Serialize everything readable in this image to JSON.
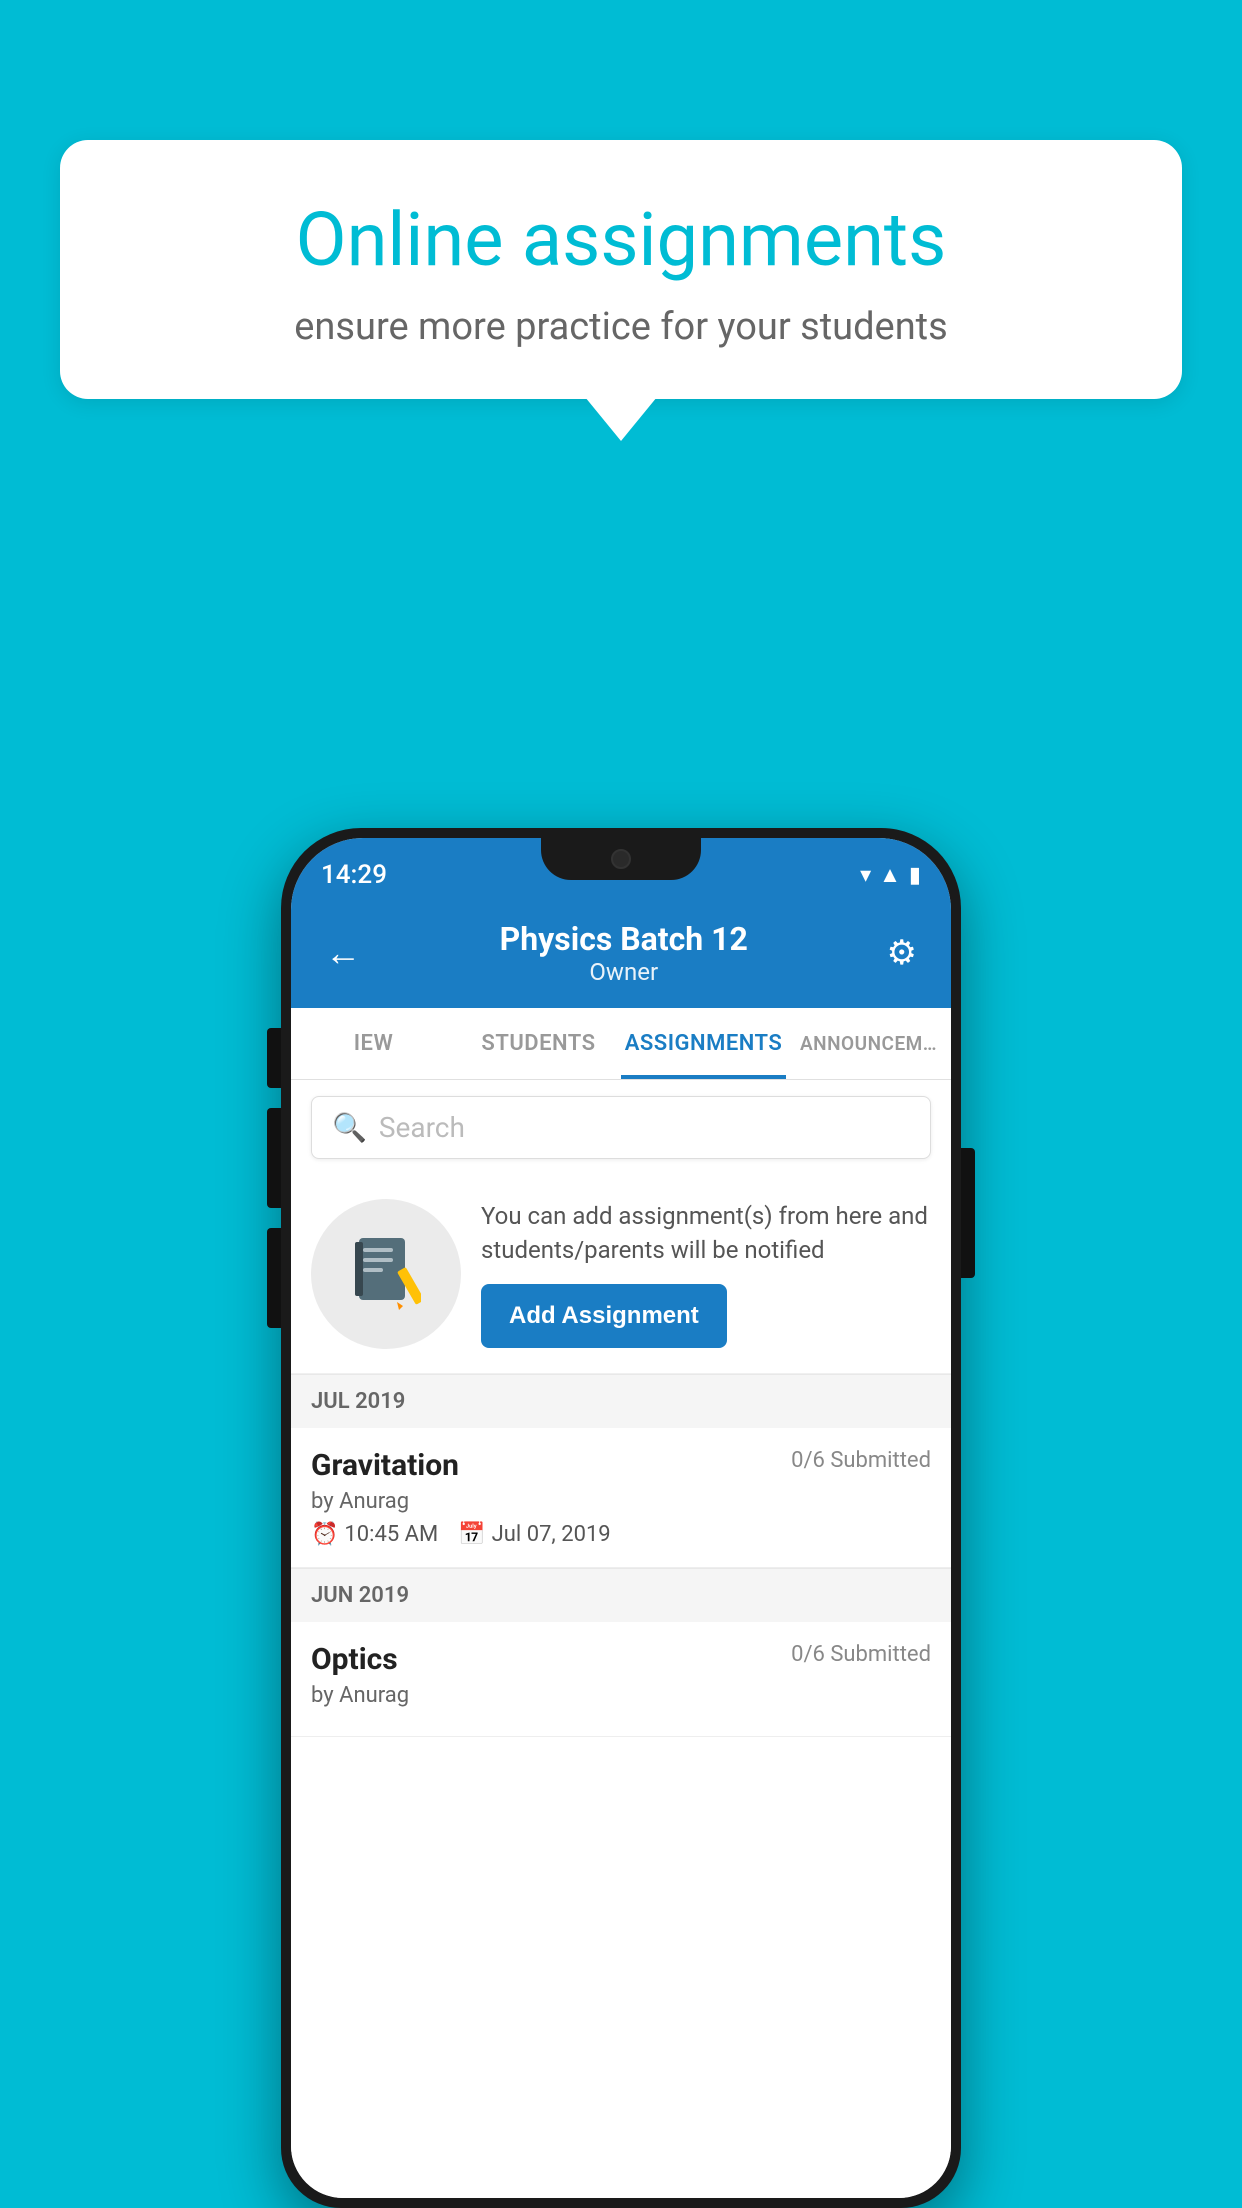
{
  "background_color": "#00BCD4",
  "speech_bubble": {
    "title": "Online assignments",
    "subtitle": "ensure more practice for your students"
  },
  "phone": {
    "status_bar": {
      "time": "14:29",
      "icons": [
        "wifi",
        "signal",
        "battery"
      ]
    },
    "header": {
      "back_label": "←",
      "title": "Physics Batch 12",
      "subtitle": "Owner",
      "settings_label": "⚙"
    },
    "tabs": [
      {
        "label": "IEW",
        "active": false
      },
      {
        "label": "STUDENTS",
        "active": false
      },
      {
        "label": "ASSIGNMENTS",
        "active": true
      },
      {
        "label": "ANNOUNCEM…",
        "active": false
      }
    ],
    "search": {
      "placeholder": "Search"
    },
    "promo": {
      "description": "You can add assignment(s) from here and students/parents will be notified",
      "button_label": "Add Assignment"
    },
    "sections": [
      {
        "label": "JUL 2019",
        "assignments": [
          {
            "title": "Gravitation",
            "submitted": "0/6 Submitted",
            "author": "by Anurag",
            "time": "10:45 AM",
            "date": "Jul 07, 2019"
          }
        ]
      },
      {
        "label": "JUN 2019",
        "assignments": [
          {
            "title": "Optics",
            "submitted": "0/6 Submitted",
            "author": "by Anurag",
            "time": "",
            "date": ""
          }
        ]
      }
    ]
  }
}
